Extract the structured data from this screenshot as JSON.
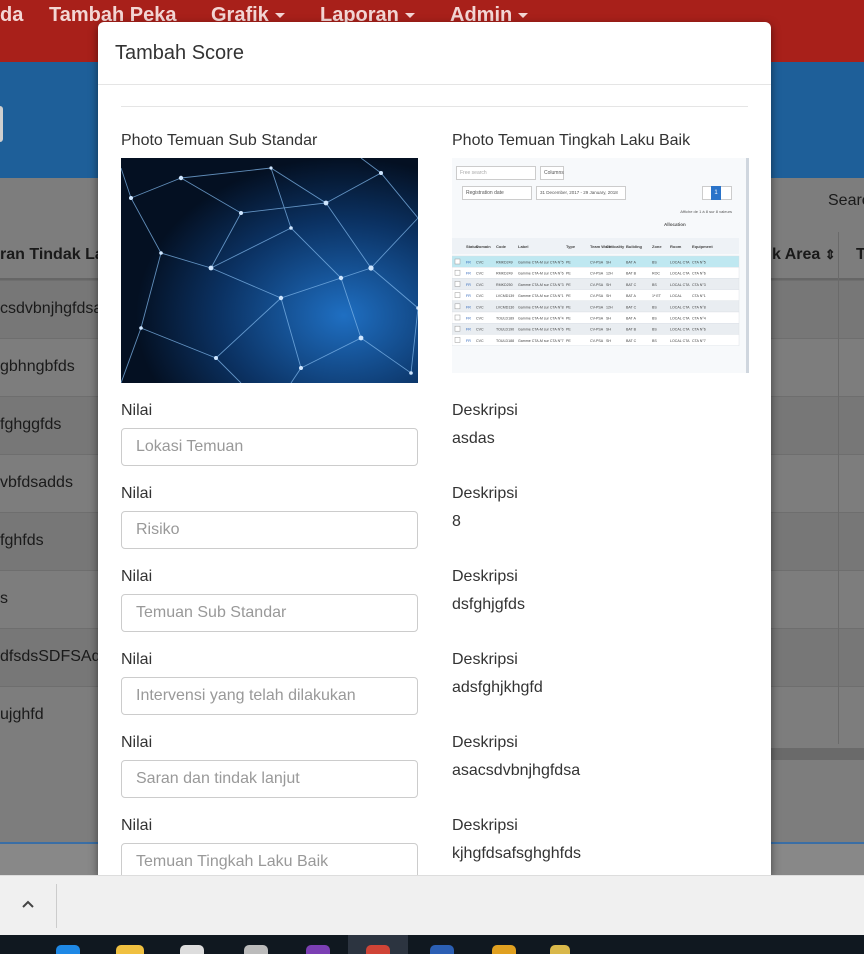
{
  "navbar": {
    "items": [
      {
        "label": "da",
        "dropdown": false
      },
      {
        "label": "Tambah Peka",
        "dropdown": false
      },
      {
        "label": "Grafik",
        "dropdown": true
      },
      {
        "label": "Laporan",
        "dropdown": true
      },
      {
        "label": "Admin",
        "dropdown": true
      }
    ]
  },
  "background_table": {
    "search_label": "Searc",
    "headers": [
      "ran Tindak La",
      "k Area",
      "T"
    ],
    "rows": [
      "csdvbnjhgfdsa",
      "gbhngbfds",
      "fghggfds",
      "vbfdsadds",
      "fghfds",
      "s",
      "dfsdsSDFSAdf",
      "ujghfd"
    ]
  },
  "modal": {
    "title": "Tambah Score",
    "photo_left_label": "Photo Temuan Sub Standar",
    "photo_right_label": "Photo Temuan Tingkah Laku Baik",
    "rows": [
      {
        "nilai_label": "Nilai",
        "placeholder": "Lokasi Temuan",
        "desc_label": "Deskripsi",
        "desc_value": "asdas"
      },
      {
        "nilai_label": "Nilai",
        "placeholder": "Risiko",
        "desc_label": "Deskripsi",
        "desc_value": "8"
      },
      {
        "nilai_label": "Nilai",
        "placeholder": "Temuan Sub Standar",
        "desc_label": "Deskripsi",
        "desc_value": "dsfghjgfds"
      },
      {
        "nilai_label": "Nilai",
        "placeholder": "Intervensi yang telah dilakukan",
        "desc_label": "Deskripsi",
        "desc_value": "adsfghjkhgfd"
      },
      {
        "nilai_label": "Nilai",
        "placeholder": "Saran dan tindak lanjut",
        "desc_label": "Deskripsi",
        "desc_value": "asacsdvbnjhgfdsa"
      },
      {
        "nilai_label": "Nilai",
        "placeholder": "Temuan Tingkah Laku Baik",
        "desc_label": "Deskripsi",
        "desc_value": "kjhgfdsafsghghfds"
      }
    ],
    "screenshot_image": {
      "search_placeholder": "Free search",
      "columns_button": "Columns",
      "date_field": "Registration date",
      "date_range": "31 December, 2017 - 29 January, 2018",
      "page": "1",
      "summary": "Affiche de 1 à 8 sur 8 valeurs",
      "group_header": "Allocation",
      "headers": [
        "Status",
        "Domain",
        "Code",
        "Label",
        "Type",
        "Team Work",
        "Criticality",
        "Building",
        "Zone",
        "Room",
        "Equipment"
      ],
      "rows": [
        [
          "FR",
          "CVC",
          "RMKD249",
          "Gamme CTA-M sur CTA N°5",
          "PE",
          "CV-PSA",
          "SH",
          "BAT A",
          "BS",
          "LOCAL CTA",
          "CTA N°5"
        ],
        [
          "FR",
          "CVC",
          "RMKD249",
          "Gamme CTA-M sur CTA N°6",
          "PE",
          "CV-PSA",
          "12H",
          "BAT B",
          "ROC",
          "LOCAL CTA",
          "CTA N°6"
        ],
        [
          "FR",
          "CVC",
          "RMKD250",
          "Gamme CTA-M sur CTA N°3",
          "PE",
          "CV-PSA",
          "SH",
          "BAT C",
          "BS",
          "LOCAL CTA",
          "CTA N°3"
        ],
        [
          "FR",
          "CVC",
          "LVCMD139",
          "Gamme CTA-M sur CTA N°1",
          "PE",
          "CV-PSA",
          "SH",
          "BAT A",
          "1ᵉ ET",
          "LOCAL",
          "CTA N°1"
        ],
        [
          "FR",
          "CVC",
          "LVCMD130",
          "Gamme CTA-M sur CTA N°8",
          "PE",
          "CV-PSA",
          "12H",
          "BAT C",
          "BS",
          "LOCAL CTA",
          "CTA N°8"
        ],
        [
          "FR",
          "CVC",
          "TOULD189",
          "Gamme CTA-M sur CTA N°4",
          "PE",
          "CV-PSA",
          "SH",
          "BAT A",
          "BS",
          "LOCAL CTA",
          "CTA N°4"
        ],
        [
          "FR",
          "CVC",
          "TOULD190",
          "Gamme CTA-M sur CTA N°6",
          "PE",
          "CV-PSA",
          "SH",
          "BAT B",
          "BS",
          "LOCAL CTA",
          "CTA N°6"
        ],
        [
          "FR",
          "CVC",
          "TOULD188",
          "Gamme CTA-M sur CTA N°7",
          "PE",
          "CV-PSA",
          "SH",
          "BAT C",
          "BS",
          "LOCAL CTA",
          "CTA N°7"
        ]
      ]
    }
  },
  "tray": {
    "chevron_icon": "chevron-up-icon"
  },
  "colors": {
    "navbar": "#a8201a",
    "header_band": "#1e5f99",
    "row_highlight": "#bfe8f1"
  }
}
